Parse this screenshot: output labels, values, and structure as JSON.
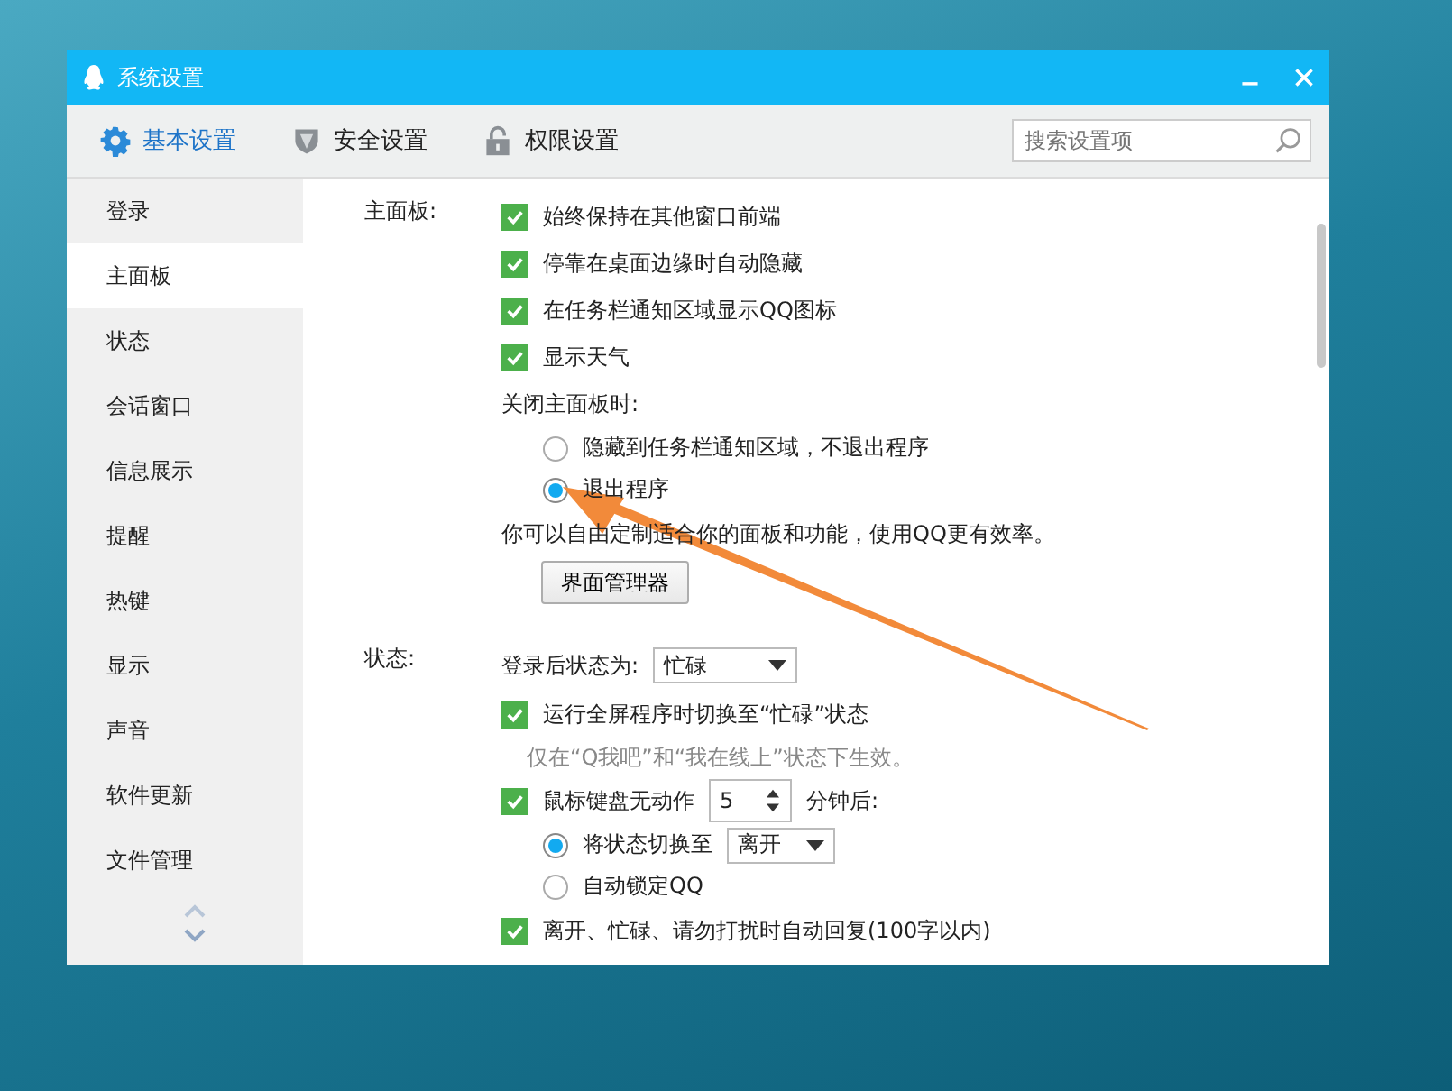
{
  "window": {
    "title": "系统设置"
  },
  "toolbar": {
    "tabs": [
      {
        "label": "基本设置",
        "selected": true
      },
      {
        "label": "安全设置",
        "selected": false
      },
      {
        "label": "权限设置",
        "selected": false
      }
    ],
    "search": {
      "placeholder": "搜索设置项"
    }
  },
  "sidebar": {
    "items": [
      {
        "label": "登录",
        "selected": false
      },
      {
        "label": "主面板",
        "selected": true
      },
      {
        "label": "状态",
        "selected": false
      },
      {
        "label": "会话窗口",
        "selected": false
      },
      {
        "label": "信息展示",
        "selected": false
      },
      {
        "label": "提醒",
        "selected": false
      },
      {
        "label": "热键",
        "selected": false
      },
      {
        "label": "显示",
        "selected": false
      },
      {
        "label": "声音",
        "selected": false
      },
      {
        "label": "软件更新",
        "selected": false
      },
      {
        "label": "文件管理",
        "selected": false
      }
    ]
  },
  "sections": [
    {
      "label": "主面板:",
      "rows": [
        {
          "kind": "checkbox",
          "label": "始终保持在其他窗口前端",
          "checked": true
        },
        {
          "kind": "checkbox",
          "label": "停靠在桌面边缘时自动隐藏",
          "checked": true
        },
        {
          "kind": "checkbox",
          "label": "在任务栏通知区域显示QQ图标",
          "checked": true
        },
        {
          "kind": "checkbox",
          "label": "显示天气",
          "checked": true
        },
        {
          "kind": "text",
          "label": "关闭主面板时:"
        },
        {
          "kind": "radio",
          "label": "隐藏到任务栏通知区域，不退出程序",
          "selected": false
        },
        {
          "kind": "radio",
          "label": "退出程序",
          "selected": true
        },
        {
          "kind": "text",
          "label": "你可以自由定制适合你的面板和功能，使用QQ更有效率。"
        },
        {
          "kind": "button",
          "label": "界面管理器"
        }
      ]
    },
    {
      "label": "状态:",
      "rows": [
        {
          "kind": "select",
          "label": "登录后状态为:",
          "value": "忙碌"
        },
        {
          "kind": "checkbox",
          "label": "运行全屏程序时切换至“忙碌”状态",
          "checked": true
        },
        {
          "kind": "hint",
          "label": "仅在“Q我吧”和“我在线上”状态下生效。"
        },
        {
          "kind": "spinner",
          "label": "鼠标键盘无动作",
          "checked": true,
          "value": "5",
          "suffix": "分钟后:"
        },
        {
          "kind": "radio-select",
          "label": "将状态切换至",
          "selected": true,
          "value": "离开"
        },
        {
          "kind": "radio",
          "label": "自动锁定QQ",
          "selected": false
        },
        {
          "kind": "checkbox",
          "label": "离开、忙碌、请勿打扰时自动回复(100字以内)",
          "checked": true
        }
      ]
    }
  ]
}
